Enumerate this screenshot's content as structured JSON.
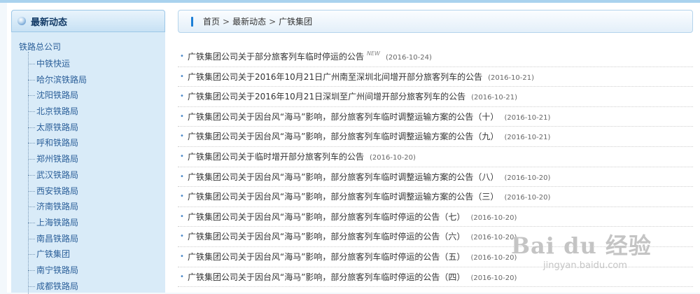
{
  "sidebar": {
    "title": "最新动态",
    "root": "铁路总公司",
    "items": [
      {
        "label": "中铁快运"
      },
      {
        "label": "哈尔滨铁路局"
      },
      {
        "label": "沈阳铁路局"
      },
      {
        "label": "北京铁路局"
      },
      {
        "label": "太原铁路局"
      },
      {
        "label": "呼和铁路局"
      },
      {
        "label": "郑州铁路局"
      },
      {
        "label": "武汉铁路局"
      },
      {
        "label": "西安铁路局"
      },
      {
        "label": "济南铁路局"
      },
      {
        "label": "上海铁路局"
      },
      {
        "label": "南昌铁路局"
      },
      {
        "label": "广铁集团"
      },
      {
        "label": "南宁铁路局"
      },
      {
        "label": "成都铁路局"
      }
    ]
  },
  "breadcrumb": {
    "home": "首页",
    "section": "最新动态",
    "current": "广铁集团",
    "sep": ">"
  },
  "news": [
    {
      "title": "广铁集团公司关于部分旅客列车临时停运的公告",
      "date": "(2016-10-24)",
      "new": "NEW"
    },
    {
      "title": "广铁集团公司关于2016年10月21日广州南至深圳北间增开部分旅客列车的公告",
      "date": "(2016-10-21)"
    },
    {
      "title": "广铁集团公司关于2016年10月21日深圳至广州间增开部分旅客列车的公告",
      "date": "(2016-10-21)"
    },
    {
      "title": "广铁集团公司关于因台风“海马”影响，部分旅客列车临时调整运输方案的公告（十）",
      "date": "(2016-10-21)"
    },
    {
      "title": "广铁集团公司关于因台风“海马”影响，部分旅客列车临时调整运输方案的公告（九）",
      "date": "(2016-10-21)"
    },
    {
      "title": "广铁集团公司关于临时增开部分旅客列车的公告",
      "date": "(2016-10-20)"
    },
    {
      "title": "广铁集团公司关于因台风“海马”影响，部分旅客列车临时调整运输方案的公告（八）",
      "date": "(2016-10-20)"
    },
    {
      "title": "广铁集团公司关于因台风“海马”影响，部分旅客列车临时调整运输方案的公告（三）",
      "date": "(2016-10-20)"
    },
    {
      "title": "广铁集团公司关于因台风“海马”影响，部分旅客列车临时停运的公告（七）",
      "date": "(2016-10-20)"
    },
    {
      "title": "广铁集团公司关于因台风“海马”影响，部分旅客列车临时停运的公告（六）",
      "date": "(2016-10-20)"
    },
    {
      "title": "广铁集团公司关于因台风“海马”影响，部分旅客列车临时停运的公告（五）",
      "date": "(2016-10-20)"
    },
    {
      "title": "广铁集团公司关于因台风“海马”影响，部分旅客列车临时停运的公告（四）",
      "date": "(2016-10-20)"
    }
  ],
  "watermark": {
    "main": "Bai du 经验",
    "sub": "jingyan.baidu.com"
  },
  "colors": {
    "accent": "#1d7fd6",
    "link": "#2b5f99",
    "sidebar_bg": "#d9ebf8"
  }
}
